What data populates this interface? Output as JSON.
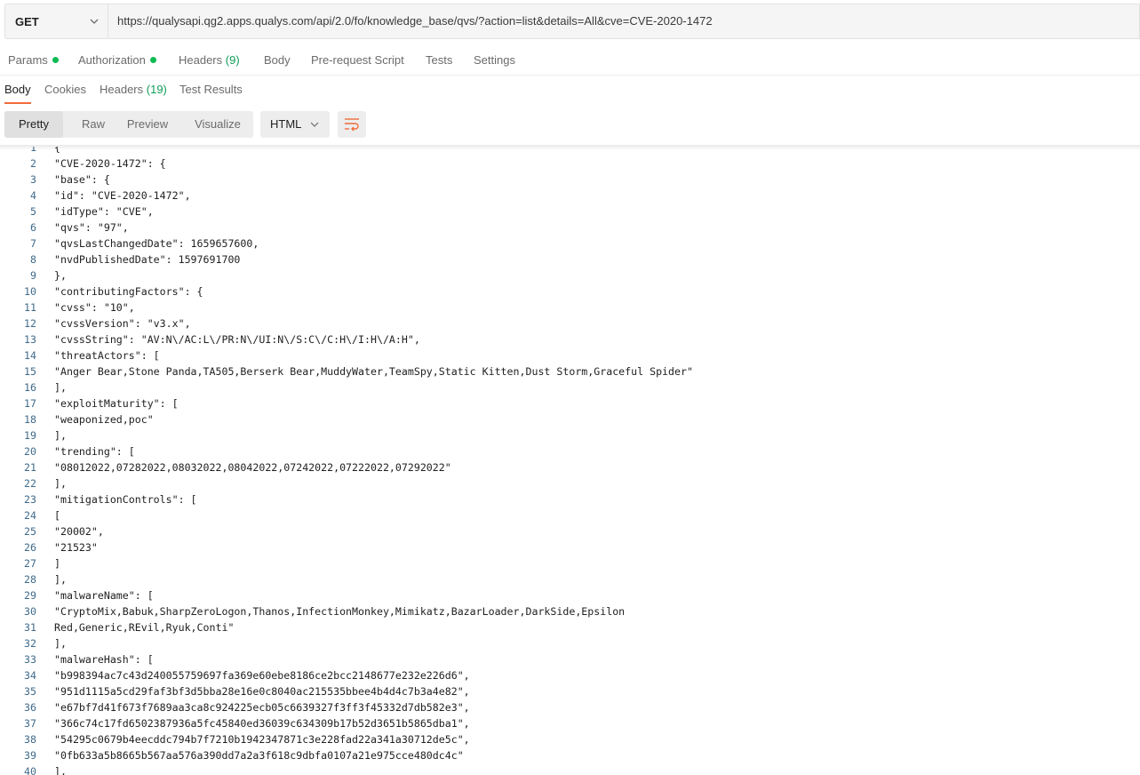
{
  "request": {
    "method": "GET",
    "url": "https://qualysapi.qg2.apps.qualys.com/api/2.0/fo/knowledge_base/qvs/?action=list&details=All&cve=CVE-2020-1472"
  },
  "request_tabs": [
    {
      "label": "Params",
      "count": "",
      "dot": true
    },
    {
      "label": "Authorization",
      "count": "",
      "dot": true
    },
    {
      "label": "Headers",
      "count": "(9)",
      "dot": false
    },
    {
      "label": "Body",
      "count": "",
      "dot": false
    },
    {
      "label": "Pre-request Script",
      "count": "",
      "dot": false
    },
    {
      "label": "Tests",
      "count": "",
      "dot": false
    },
    {
      "label": "Settings",
      "count": "",
      "dot": false
    }
  ],
  "response_tabs": [
    {
      "label": "Body",
      "count": "",
      "active": true
    },
    {
      "label": "Cookies",
      "count": "",
      "active": false
    },
    {
      "label": "Headers",
      "count": "(19)",
      "active": false
    },
    {
      "label": "Test Results",
      "count": "",
      "active": false
    }
  ],
  "format_buttons": [
    "Pretty",
    "Raw",
    "Preview",
    "Visualize"
  ],
  "active_format": "Pretty",
  "language": "HTML",
  "icons": {
    "method_dropdown": "chevron-down-icon",
    "language_dropdown": "chevron-down-icon",
    "wrap": "wrap-lines-icon"
  },
  "colors": {
    "accent": "#f26b3a",
    "status_dot": "#0cbb52",
    "line_number": "#3f6a8a"
  },
  "editor": {
    "lines": [
      {
        "n": "1",
        "text": "{"
      },
      {
        "n": "2",
        "text": "\"CVE-2020-1472\": {"
      },
      {
        "n": "3",
        "text": "\"base\": {"
      },
      {
        "n": "4",
        "text": "\"id\": \"CVE-2020-1472\","
      },
      {
        "n": "5",
        "text": "\"idType\": \"CVE\","
      },
      {
        "n": "6",
        "text": "\"qvs\": \"97\","
      },
      {
        "n": "7",
        "text": "\"qvsLastChangedDate\": 1659657600,"
      },
      {
        "n": "8",
        "text": "\"nvdPublishedDate\": 1597691700"
      },
      {
        "n": "9",
        "text": "},"
      },
      {
        "n": "10",
        "text": "\"contributingFactors\": {"
      },
      {
        "n": "11",
        "text": "\"cvss\": \"10\","
      },
      {
        "n": "12",
        "text": "\"cvssVersion\": \"v3.x\","
      },
      {
        "n": "13",
        "text": "\"cvssString\": \"AV:N\\/AC:L\\/PR:N\\/UI:N\\/S:C\\/C:H\\/I:H\\/A:H\","
      },
      {
        "n": "14",
        "text": "\"threatActors\": ["
      },
      {
        "n": "15",
        "text": "\"Anger Bear,Stone Panda,TA505,Berserk Bear,MuddyWater,TeamSpy,Static Kitten,Dust Storm,Graceful Spider\""
      },
      {
        "n": "16",
        "text": "],"
      },
      {
        "n": "17",
        "text": "\"exploitMaturity\": ["
      },
      {
        "n": "18",
        "text": "\"weaponized,poc\""
      },
      {
        "n": "19",
        "text": "],"
      },
      {
        "n": "20",
        "text": "\"trending\": ["
      },
      {
        "n": "21",
        "text": "\"08012022,07282022,08032022,08042022,07242022,07222022,07292022\""
      },
      {
        "n": "22",
        "text": "],"
      },
      {
        "n": "23",
        "text": "\"mitigationControls\": ["
      },
      {
        "n": "24",
        "text": "["
      },
      {
        "n": "25",
        "text": "\"20002\","
      },
      {
        "n": "26",
        "text": "\"21523\""
      },
      {
        "n": "27",
        "text": "]"
      },
      {
        "n": "28",
        "text": "],"
      },
      {
        "n": "29",
        "text": "\"malwareName\": ["
      },
      {
        "n": "30",
        "text": "\"CryptoMix,Babuk,SharpZeroLogon,Thanos,InfectionMonkey,Mimikatz,BazarLoader,DarkSide,Epsilon"
      },
      {
        "n": "31",
        "text": "Red,Generic,REvil,Ryuk,Conti\""
      },
      {
        "n": "32",
        "text": "],"
      },
      {
        "n": "33",
        "text": "\"malwareHash\": ["
      },
      {
        "n": "34",
        "text": "\"b998394ac7c43d240055759697fa369e60ebe8186ce2bcc2148677e232e226d6\","
      },
      {
        "n": "35",
        "text": "\"951d1115a5cd29faf3bf3d5bba28e16e0c8040ac215535bbee4b4d4c7b3a4e82\","
      },
      {
        "n": "36",
        "text": "\"e67bf7d41f673f7689aa3ca8c924225ecb05c6639327f3ff3f45332d7db582e3\","
      },
      {
        "n": "37",
        "text": "\"366c74c17fd6502387936a5fc45840ed36039c634309b17b52d3651b5865dba1\","
      },
      {
        "n": "38",
        "text": "\"54295c0679b4eecddc794b7f7210b1942347871c3e228fad22a341a30712de5c\","
      },
      {
        "n": "39",
        "text": "\"0fb633a5b8665b567aa576a390dd7a2a3f618c9dbfa0107a21e975cce480dc4c\""
      },
      {
        "n": "40",
        "text": "],"
      }
    ]
  }
}
